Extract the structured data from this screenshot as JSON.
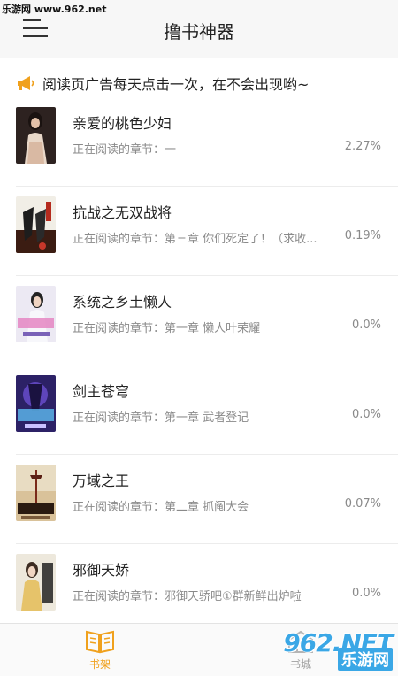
{
  "watermark_top": "乐游网 www.962.net",
  "header": {
    "title": "撸书神器"
  },
  "notice": {
    "text": "阅读页广告每天点击一次，在不会出现哟~"
  },
  "books": [
    {
      "title": "亲爱的桃色少妇",
      "chapter": "正在阅读的章节：一",
      "progress": "2.27%",
      "cover_color": "#3a2b28"
    },
    {
      "title": "抗战之无双战将",
      "chapter": "正在阅读的章节：第三章 你们死定了！（求收...",
      "progress": "0.19%",
      "cover_color": "#6e2b1e"
    },
    {
      "title": "系统之乡土懒人",
      "chapter": "正在阅读的章节：第一章 懒人叶荣耀",
      "progress": "0.0%",
      "cover_color": "#d8d3e8"
    },
    {
      "title": "剑主苍穹",
      "chapter": "正在阅读的章节：第一章 武者登记",
      "progress": "0.0%",
      "cover_color": "#3b2a7a"
    },
    {
      "title": "万域之王",
      "chapter": "正在阅读的章节：第二章 抓阄大会",
      "progress": "0.07%",
      "cover_color": "#c9a36a"
    },
    {
      "title": "邪御天娇",
      "chapter": "正在阅读的章节：邪御天骄吧①群新鲜出炉啦",
      "progress": "0.0%",
      "cover_color": "#d7d0c4"
    }
  ],
  "tabs": {
    "shelf": {
      "label": "书架",
      "icon": "bookshelf-icon",
      "active": true
    },
    "store": {
      "label": "书城",
      "icon": "bookstore-icon",
      "active": false
    }
  },
  "watermark_bottom": {
    "number": "962.NET",
    "text": "乐游网"
  },
  "colors": {
    "accent": "#f0a11d",
    "text_primary": "#222222",
    "text_secondary": "#8a8a8a",
    "watermark_blue": "#3aa7e6"
  }
}
